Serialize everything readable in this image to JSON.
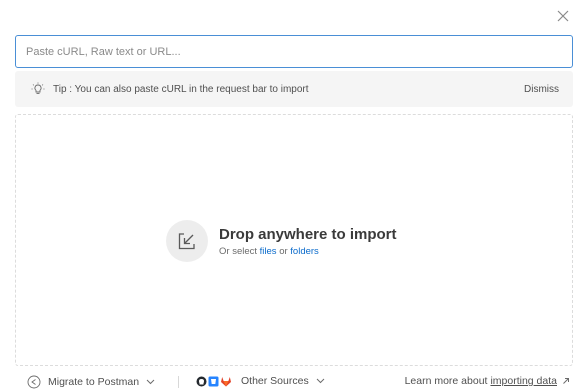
{
  "input": {
    "placeholder": "Paste cURL, Raw text or URL..."
  },
  "tip": {
    "text": "Tip : You can also paste cURL in the request bar to import",
    "dismiss_label": "Dismiss"
  },
  "drop": {
    "title": "Drop anywhere to import",
    "sub_prefix": "Or select",
    "files_label": "files",
    "or_label": "or",
    "folders_label": "folders"
  },
  "footer": {
    "migrate_label": "Migrate to Postman",
    "sources_label": "Other Sources",
    "learn_prefix": "Learn more about",
    "learn_link": "importing data"
  },
  "colors": {
    "accent": "#4a8fd6",
    "link": "#0b6bcb",
    "gitlab": "#e24329",
    "bitbucket": "#2684ff",
    "github": "#24292e"
  },
  "icons": {
    "close": "close-icon",
    "tip": "lightbulb-icon",
    "drop": "import-arrow-icon",
    "migrate": "migrate-icon",
    "github": "github-icon",
    "bitbucket": "bitbucket-icon",
    "gitlab": "gitlab-icon",
    "external": "external-link-icon"
  }
}
